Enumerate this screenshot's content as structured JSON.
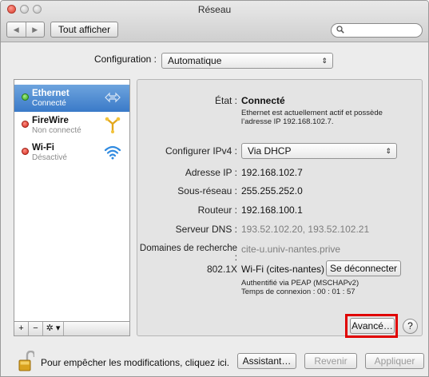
{
  "window": {
    "title": "Réseau"
  },
  "toolbar": {
    "back_icon": "◀",
    "forward_icon": "▶",
    "show_all_label": "Tout afficher",
    "search_placeholder": ""
  },
  "configuration": {
    "label": "Configuration :",
    "value": "Automatique"
  },
  "sidebar": {
    "services": [
      {
        "name": "Ethernet",
        "status": "Connecté",
        "dot": "green",
        "icon": "ethernet-arrows-icon",
        "selected": true
      },
      {
        "name": "FireWire",
        "status": "Non connecté",
        "dot": "red",
        "icon": "firewire-icon",
        "selected": false
      },
      {
        "name": "Wi-Fi",
        "status": "Désactivé",
        "dot": "red",
        "icon": "wifi-icon",
        "selected": false
      }
    ],
    "tools": {
      "add": "+",
      "remove": "−",
      "actions": "✲ ▾"
    }
  },
  "detail": {
    "state_label": "État :",
    "state_value": "Connecté",
    "state_desc_line1": "Ethernet est actuellement actif et possède",
    "state_desc_line2": "l’adresse IP 192.168.102.7.",
    "ipv4_label": "Configurer IPv4 :",
    "ipv4_value": "Via DHCP",
    "ip_label": "Adresse IP :",
    "ip_value": "192.168.102.7",
    "subnet_label": "Sous-réseau :",
    "subnet_value": "255.255.252.0",
    "router_label": "Routeur :",
    "router_value": "192.168.100.1",
    "dns_label": "Serveur DNS :",
    "dns_value": "193.52.102.20, 193.52.102.21",
    "search_domains_label": "Domaines de recherche :",
    "search_domains_value": "cite-u.univ-nantes.prive",
    "auth_label": "802.1X",
    "auth_value": "Wi-Fi (cites-nantes)",
    "disconnect_label": "Se déconnecter",
    "auth_info_line1": "Authentifié via PEAP (MSCHAPv2)",
    "auth_info_line2": "Temps de connexion : 00 : 01 : 57",
    "advanced_label": "Avancé…",
    "help_label": "?"
  },
  "footer": {
    "lock_text": "Pour empêcher les modifications, cliquez ici.",
    "assistant_label": "Assistant…",
    "revert_label": "Revenir",
    "apply_label": "Appliquer"
  },
  "colors": {
    "selected_row": "#3a7ac8",
    "highlight": "#e00000",
    "connected": "#32a31a",
    "disconnected": "#cf2417"
  }
}
